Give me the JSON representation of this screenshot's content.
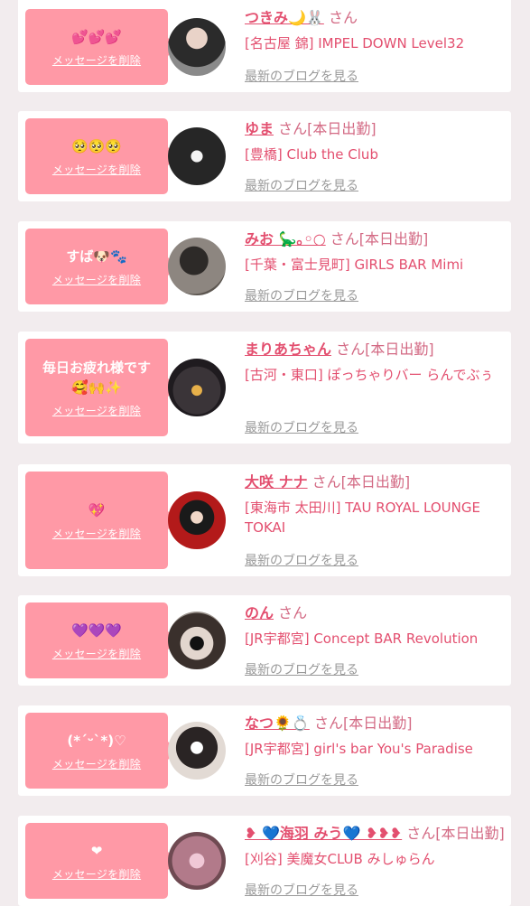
{
  "cards": [
    {
      "message": "💕💕💕",
      "delete_label": "メッセージを削除",
      "name": "つきみ🌙🐰",
      "suffix": "さん",
      "shop": "[名古屋 錦] IMPEL DOWN Level32",
      "blog_link": "最新のブログを見る",
      "avatar_color": "#6b6b6b"
    },
    {
      "message": "🥺🥺🥺",
      "delete_label": "メッセージを削除",
      "name": "ゆま",
      "suffix": "さん[本日出勤]",
      "shop": "[豊橋] Club the Club",
      "blog_link": "最新のブログを見る",
      "avatar_color": "#3a3a3a"
    },
    {
      "message": "すば🐶🐾",
      "delete_label": "メッセージを削除",
      "name": "みお 🦕｡◦○",
      "suffix": "さん[本日出勤]",
      "shop": "[千葉・富士見町] GIRLS BAR Mimi",
      "blog_link": "最新のブログを見る",
      "avatar_color": "#5b5752"
    },
    {
      "message": "毎日お疲れ様です\n🥰🙌✨",
      "delete_label": "メッセージを削除",
      "name": "まりあちゃん",
      "suffix": "さん[本日出勤]",
      "shop": "[古河・東口] ぽっちゃりバー らんでぶぅ",
      "blog_link": "最新のブログを見る",
      "avatar_color": "#2e2a2e"
    },
    {
      "message": "💖",
      "delete_label": "メッセージを削除",
      "name": "大咲 ナナ",
      "suffix": "さん[本日出勤]",
      "shop": "[東海市 太田川] TAU ROYAL LOUNGE TOKAI",
      "blog_link": "最新のブログを見る",
      "avatar_color": "#b31a1a"
    },
    {
      "message": "💜💜💜",
      "delete_label": "メッセージを削除",
      "name": "のん",
      "suffix": "さん",
      "shop": "[JR宇都宮] Concept BAR Revolution",
      "blog_link": "最新のブログを見る",
      "avatar_color": "#8c8480"
    },
    {
      "message": "(*ˊᵕˋ*)♡",
      "delete_label": "メッセージを削除",
      "name": "なつ🌻💍",
      "suffix": "さん[本日出勤]",
      "shop": "[JR宇都宮] girl's bar You's Paradise",
      "blog_link": "最新のブログを見る",
      "avatar_color": "#d8cfc8"
    },
    {
      "message": "❤",
      "delete_label": "メッセージを削除",
      "name": "❥ 💙海羽 みう💙 ❥❥❥",
      "suffix": "さん[本日出勤]",
      "shop": "[刈谷] 美魔女CLUB みしゅらん",
      "blog_link": "最新のブログを見る",
      "avatar_color": "#b27a8a"
    }
  ]
}
